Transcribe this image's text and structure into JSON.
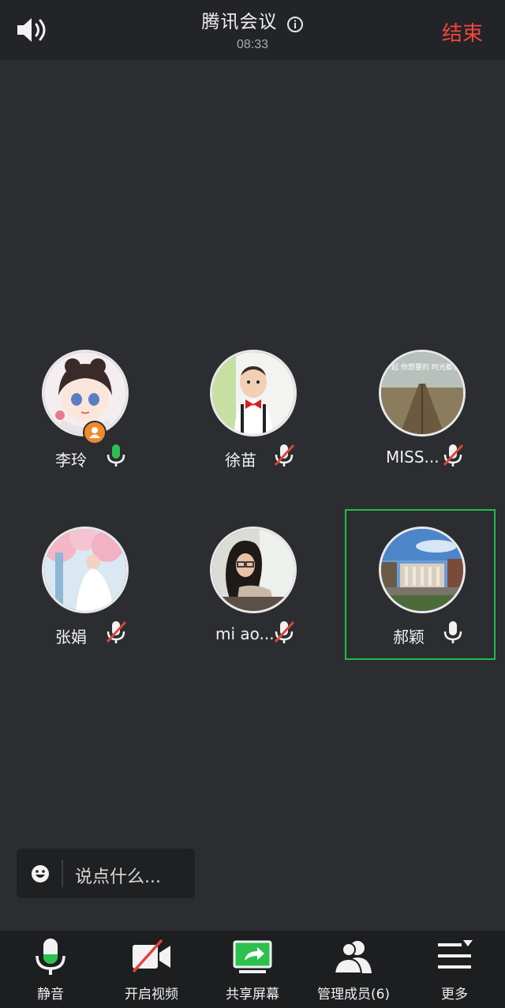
{
  "header": {
    "title": "腾讯会议",
    "time": "08:33",
    "end_label": "结束",
    "speaker_icon": "speaker-icon",
    "info_icon": "info-icon"
  },
  "participants": [
    {
      "name": "李玲",
      "mic": "on",
      "host": true
    },
    {
      "name": "徐苗",
      "mic": "muted",
      "host": false
    },
    {
      "name": "MISS...",
      "mic": "muted",
      "host": false,
      "avatar_text": "我们一起 你想要的 时光都会给你"
    },
    {
      "name": "张娟",
      "mic": "muted",
      "host": false
    },
    {
      "name": "mi ao...",
      "mic": "muted",
      "host": false
    },
    {
      "name": "郝颖",
      "mic": "on-white",
      "host": false,
      "active": true
    }
  ],
  "chat": {
    "placeholder": "说点什么...",
    "emoji_icon": "emoji-icon"
  },
  "toolbar": {
    "items": [
      {
        "label": "静音",
        "icon": "mic-icon"
      },
      {
        "label": "开启视频",
        "icon": "video-off-icon"
      },
      {
        "label": "共享屏幕",
        "icon": "share-screen-icon"
      },
      {
        "label": "管理成员(6)",
        "icon": "members-icon"
      },
      {
        "label": "更多",
        "icon": "more-icon"
      }
    ]
  },
  "colors": {
    "background": "#2b2d30",
    "end_red": "#f0463c",
    "mic_green": "#2cc14f",
    "muted_red": "#e0443a",
    "active_border": "#1dbd4a"
  }
}
